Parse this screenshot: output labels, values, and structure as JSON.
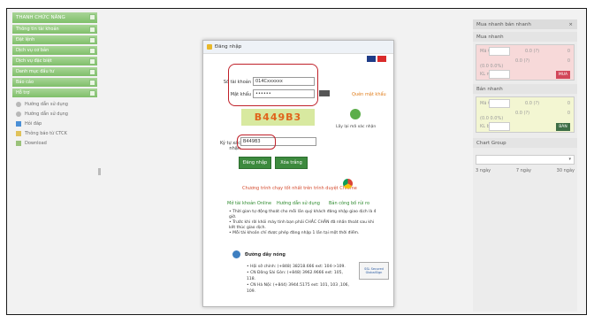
{
  "sidebar": {
    "header": "THANH CHỨC NĂNG",
    "items": [
      "Thông tin tài khoản",
      "Đặt lệnh",
      "Dịch vụ cơ bản",
      "Dịch vụ đặc biệt",
      "Danh mục đầu tư",
      "Báo cáo",
      "Hỗ trợ"
    ],
    "subitems": [
      "Hướng dẫn sử dụng",
      "Hướng dẫn sử dụng",
      "Hỏi đáp",
      "Thông báo từ CTCK",
      "Download"
    ]
  },
  "dialog": {
    "title": "Đăng nhập",
    "account_label": "Số tài khoản",
    "account_value": "014Cxxxxxx",
    "password_label": "Mật khẩu",
    "password_value": "••••••",
    "forgot": "Quên mật khẩu",
    "captcha": "B449B3",
    "refresh": "Lấy lại mã xác nhận",
    "captcha_label": "Ký tự xác nhận",
    "captcha_value": "B449B3",
    "login_btn": "Đăng nhập",
    "clear_btn": "Xóa trắng",
    "chrome_note": "Chương trình chạy tốt nhất trên trình duyệt Chrome",
    "links": [
      "Mở tài khoản Online",
      "Hướng dẫn sử dụng",
      "Bản công bố rủi ro"
    ],
    "bullets": [
      "Thời gian tự động thoát cho mỗi lần quý khách đăng nhập giao dịch là 4 giờ.",
      "Trước khi rời khỏi máy tính bạn phải CHẮC CHẮN đã nhấn thoát sau khi kết thúc giao dịch.",
      "Mỗi tài khoản chỉ được phép đăng nhập 1 lần tại một thời điểm."
    ],
    "hotline_title": "Đường dây nóng",
    "hotlines": [
      "Hội sở chính: (+848) 38218.666 ext: 104->109.",
      "CN Đông Sài Gòn: (+848) 3962.9666 ext: 105, 118.",
      "CN Hà Nội: (+844) 3944.5175 ext: 101, 103 ,106, 109."
    ],
    "ssl": "SSL Secured GlobalSign"
  },
  "right": {
    "title": "Mua nhanh bán nhanh",
    "close": "×",
    "buy_header": "Mua nhanh",
    "buy_code": "Mã CK",
    "buy_price": "0.0 (?)",
    "buy_zero1": "0",
    "buy_price2": "0.0 (?)",
    "buy_zero2": "0",
    "buy_pct": "(0.0 0.0%)",
    "buy_qty": "KL mua",
    "buy_btn": "MUA",
    "sell_header": "Bán nhanh",
    "sell_code": "Mã CK",
    "sell_price": "0.0 (?)",
    "sell_zero1": "0",
    "sell_price2": "0.0 (?)",
    "sell_zero2": "0",
    "sell_pct": "(0.0 0.0%)",
    "sell_qty": "KL bán",
    "sell_btn": "BÁN",
    "chart_header": "Chart Group",
    "ranges": [
      "3 ngày",
      "7 ngày",
      "30 ngày"
    ]
  }
}
